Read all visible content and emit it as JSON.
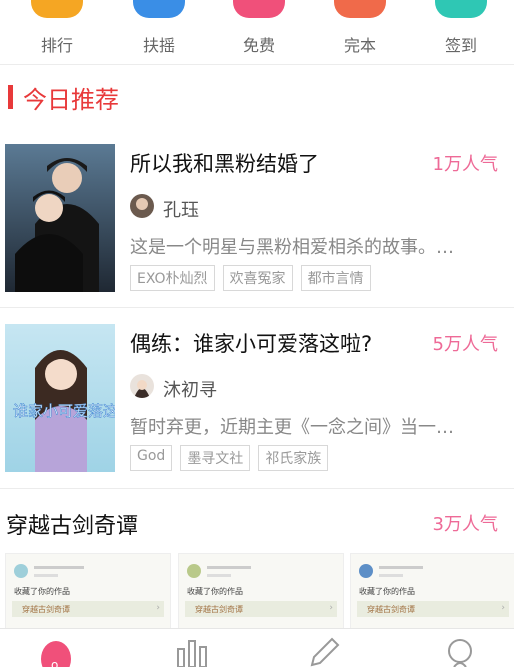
{
  "top_nav": [
    {
      "label": "排行",
      "color": "#f5a623"
    },
    {
      "label": "扶摇",
      "color": "#3a8ee6"
    },
    {
      "label": "免费",
      "color": "#f0507a"
    },
    {
      "label": "完本",
      "color": "#f06a4a"
    },
    {
      "label": "签到",
      "color": "#2fc7b4"
    }
  ],
  "section_title": "今日推荐",
  "books": [
    {
      "title": "所以我和黑粉结婚了",
      "popularity": "1万人气",
      "author": "孔珏",
      "description": "这是一个明星与黑粉相爱相杀的故事。…",
      "tags": [
        "EXO朴灿烈",
        "欢喜冤家",
        "都市言情"
      ]
    },
    {
      "title": "偶练：谁家小可爱落这啦?",
      "popularity": "5万人气",
      "author": "沐初寻",
      "description": "暂时弃更，近期主更《一念之间》当一…",
      "tags": [
        "God",
        "墨寻文社",
        "祁氏家族"
      ],
      "cover_text": "谁家小可爱落这啦"
    }
  ],
  "section2": {
    "title": "穿越古剑奇谭",
    "popularity": "3万人气"
  },
  "comment_cards": [
    {
      "text": "收藏了你的作品",
      "button": "穿越古剑奇谭"
    },
    {
      "text": "收藏了你的作品",
      "button": "穿越古剑奇谭"
    },
    {
      "text": "收藏了你的作品",
      "button": "穿越古剑奇谭"
    }
  ],
  "accent": "#e8393a",
  "pink": "#ee6a97"
}
